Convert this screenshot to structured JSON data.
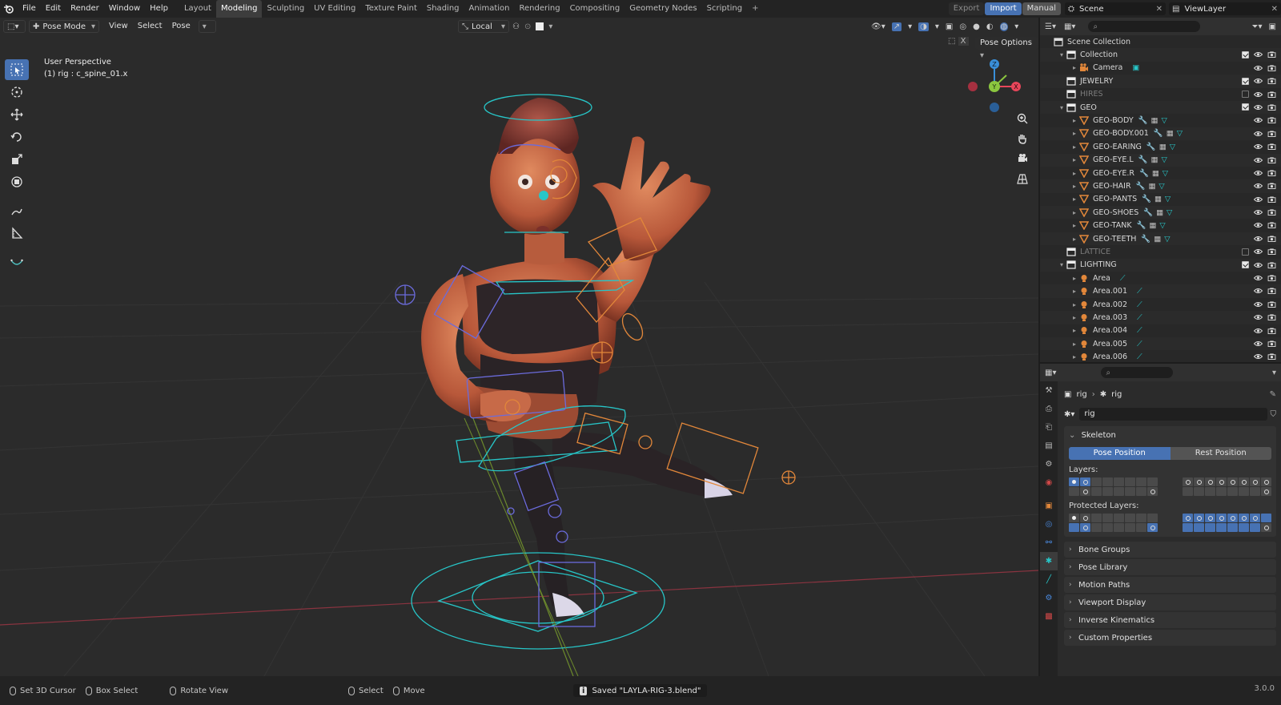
{
  "menu": [
    "File",
    "Edit",
    "Render",
    "Window",
    "Help"
  ],
  "workspaces": [
    {
      "label": "Layout",
      "active": false
    },
    {
      "label": "Modeling",
      "active": true
    },
    {
      "label": "Sculpting",
      "active": false
    },
    {
      "label": "UV Editing",
      "active": false
    },
    {
      "label": "Texture Paint",
      "active": false
    },
    {
      "label": "Shading",
      "active": false
    },
    {
      "label": "Animation",
      "active": false
    },
    {
      "label": "Rendering",
      "active": false
    },
    {
      "label": "Compositing",
      "active": false
    },
    {
      "label": "Geometry Nodes",
      "active": false
    },
    {
      "label": "Scripting",
      "active": false
    }
  ],
  "top_right": {
    "export": "Export",
    "import": "Import",
    "manual": "Manual",
    "scene": "Scene",
    "view_layer": "ViewLayer"
  },
  "viewport": {
    "mode": "Pose Mode",
    "menus": [
      "View",
      "Select",
      "Pose"
    ],
    "orientation": "Local",
    "pose_options": "Pose Options",
    "info_line1": "User Perspective",
    "info_line2": "(1) rig : c_spine_01.x",
    "gizmo_axes": [
      "Z",
      "Y",
      "X"
    ]
  },
  "outliner": {
    "rows": [
      {
        "label": "Scene Collection",
        "type": "scene",
        "indent": 0,
        "arrow": "",
        "check": "none"
      },
      {
        "label": "Collection",
        "type": "collection",
        "indent": 1,
        "arrow": "▾",
        "check": "on"
      },
      {
        "label": "Camera",
        "type": "camera",
        "indent": 2,
        "arrow": "▸",
        "check": "none"
      },
      {
        "label": "JEWELRY",
        "type": "collection",
        "indent": 1,
        "arrow": "",
        "check": "on"
      },
      {
        "label": "HIRES",
        "type": "collection",
        "indent": 1,
        "arrow": "",
        "check": "off",
        "dim": true
      },
      {
        "label": "GEO",
        "type": "collection",
        "indent": 1,
        "arrow": "▾",
        "check": "on"
      },
      {
        "label": "GEO-BODY",
        "type": "mesh",
        "indent": 2,
        "arrow": "▸",
        "check": "none",
        "mods": true
      },
      {
        "label": "GEO-BODY.001",
        "type": "mesh",
        "indent": 2,
        "arrow": "▸",
        "check": "none",
        "mods": true
      },
      {
        "label": "GEO-EARING",
        "type": "mesh",
        "indent": 2,
        "arrow": "▸",
        "check": "none",
        "mods": true
      },
      {
        "label": "GEO-EYE.L",
        "type": "mesh",
        "indent": 2,
        "arrow": "▸",
        "check": "none",
        "mods": true
      },
      {
        "label": "GEO-EYE.R",
        "type": "mesh",
        "indent": 2,
        "arrow": "▸",
        "check": "none",
        "mods": true
      },
      {
        "label": "GEO-HAIR",
        "type": "mesh",
        "indent": 2,
        "arrow": "▸",
        "check": "none",
        "mods": true
      },
      {
        "label": "GEO-PANTS",
        "type": "mesh",
        "indent": 2,
        "arrow": "▸",
        "check": "none",
        "mods": true
      },
      {
        "label": "GEO-SHOES",
        "type": "mesh",
        "indent": 2,
        "arrow": "▸",
        "check": "none",
        "mods": true
      },
      {
        "label": "GEO-TANK",
        "type": "mesh",
        "indent": 2,
        "arrow": "▸",
        "check": "none",
        "mods": true
      },
      {
        "label": "GEO-TEETH",
        "type": "mesh",
        "indent": 2,
        "arrow": "▸",
        "check": "none",
        "mods": true
      },
      {
        "label": "LATTICE",
        "type": "collection",
        "indent": 1,
        "arrow": "",
        "check": "off",
        "dim": true
      },
      {
        "label": "LIGHTING",
        "type": "collection",
        "indent": 1,
        "arrow": "▾",
        "check": "on"
      },
      {
        "label": "Area",
        "type": "light",
        "indent": 2,
        "arrow": "▸",
        "check": "none"
      },
      {
        "label": "Area.001",
        "type": "light",
        "indent": 2,
        "arrow": "▸",
        "check": "none"
      },
      {
        "label": "Area.002",
        "type": "light",
        "indent": 2,
        "arrow": "▸",
        "check": "none"
      },
      {
        "label": "Area.003",
        "type": "light",
        "indent": 2,
        "arrow": "▸",
        "check": "none"
      },
      {
        "label": "Area.004",
        "type": "light",
        "indent": 2,
        "arrow": "▸",
        "check": "none"
      },
      {
        "label": "Area.005",
        "type": "light",
        "indent": 2,
        "arrow": "▸",
        "check": "none"
      },
      {
        "label": "Area.006",
        "type": "light",
        "indent": 2,
        "arrow": "▸",
        "check": "none"
      }
    ]
  },
  "properties": {
    "breadcrumb_object": "rig",
    "breadcrumb_data": "rig",
    "data_name": "rig",
    "skeleton_title": "Skeleton",
    "pose_position": "Pose Position",
    "rest_position": "Rest Position",
    "layers_label": "Layers:",
    "protected_label": "Protected Layers:",
    "panels": [
      "Bone Groups",
      "Pose Library",
      "Motion Paths",
      "Viewport Display",
      "Inverse Kinematics",
      "Custom Properties"
    ]
  },
  "status": {
    "set_cursor": "Set 3D Cursor",
    "box_select": "Box Select",
    "rotate_view": "Rotate View",
    "select": "Select",
    "move": "Move",
    "saved": "Saved \"LAYLA-RIG-3.blend\"",
    "version": "3.0.0"
  },
  "colors": {
    "accent": "#4772b3",
    "axis_x": "#e8465a",
    "axis_y": "#8bc63f",
    "axis_z": "#3a8fd8",
    "object_orange": "#e2873a",
    "rig_cyan": "#27c6c8"
  }
}
